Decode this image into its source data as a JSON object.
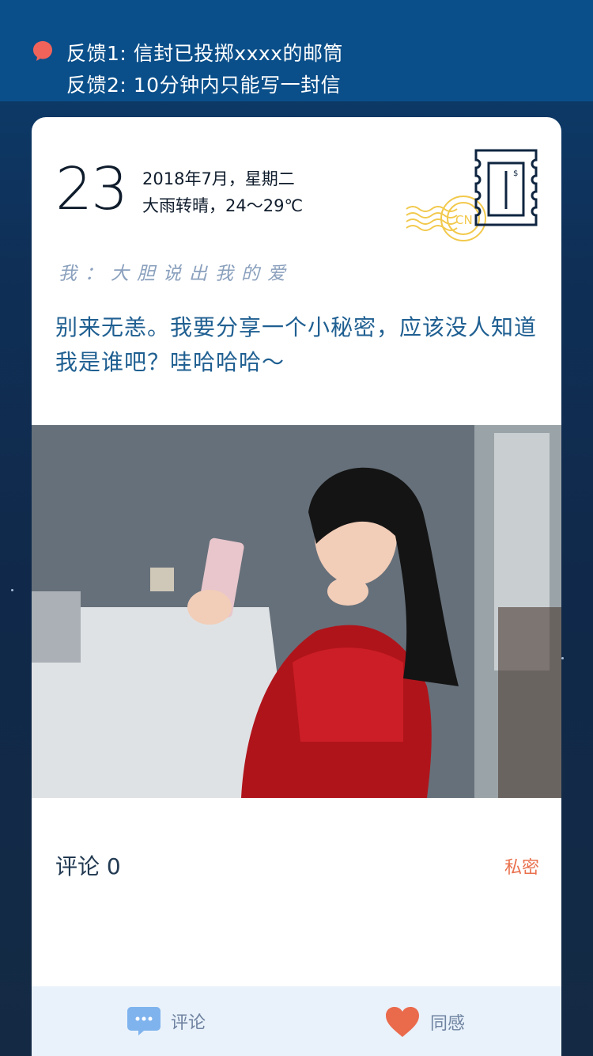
{
  "banner": {
    "line1": "反馈1: 信封已投掷xxxx的邮筒",
    "line2": "反馈2: 10分钟内只能写一封信",
    "dot_color": "#f0635a"
  },
  "letter": {
    "day": "23",
    "date": "2018年7月，星期二",
    "weather": "大雨转晴，24～29℃",
    "stamp_postmark_text": "CN",
    "greeting": "我：大胆说出我的爱",
    "body": "别来无恙。我要分享一个小秘密，应该没人知道我是谁吧？哇哈哈哈～"
  },
  "comments": {
    "label": "评论 0",
    "privacy": "私密"
  },
  "bottom_bar": {
    "comment_label": "评论",
    "comment_icon": "comment-bubble-icon",
    "like_label": "同感",
    "like_icon": "heart-icon"
  },
  "colors": {
    "accent_orange": "#e9714e",
    "text_blue": "#1f5f91",
    "bar_bg": "#e9f2fb"
  }
}
